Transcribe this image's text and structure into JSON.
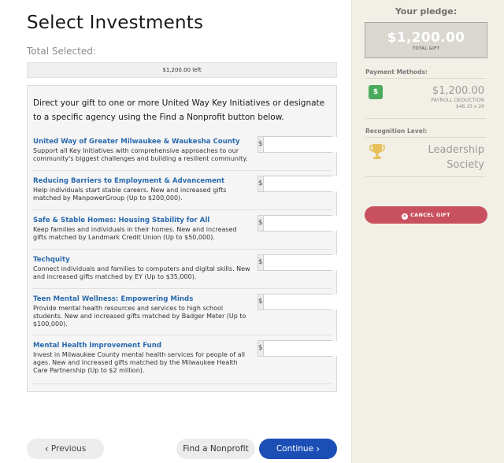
{
  "page": {
    "title": "Select Investments",
    "total_selected_label": "Total Selected:",
    "remaining_text": "$1,200.00 left",
    "allocated_fraction": 0,
    "intro": "Direct your gift to one or more United Way Key Initiatives or designate to a specific agency using the Find a Nonprofit button below."
  },
  "initiatives": [
    {
      "name": "United Way of Greater Milwaukee & Waukesha County",
      "description": "Support all Key Initiatives with comprehensive approaches to our community's biggest challenges and building a resilient community.",
      "currency": "$",
      "amount": "0"
    },
    {
      "name": "Reducing Barriers to Employment & Advancement",
      "description": "Help individuals start stable careers. New and increased gifts matched by ManpowerGroup (Up to $200,000).",
      "currency": "$",
      "amount": "0"
    },
    {
      "name": "Safe & Stable Homes: Housing Stability for All",
      "description": "Keep families and individuals in their homes. New and increased gifts matched by Landmark Credit Union (Up to $50,000).",
      "currency": "$",
      "amount": "0"
    },
    {
      "name": "Techquity",
      "description": "Connect individuals and families to computers and digital skills. New and increased gifts matched by EY (Up to $35,000).",
      "currency": "$",
      "amount": "0"
    },
    {
      "name": "Teen Mental Wellness: Empowering Minds",
      "description": "Provide mental health resources and services to high school students. New and increased gifts matched by Badger Meter (Up to $100,000).",
      "currency": "$",
      "amount": "0"
    },
    {
      "name": "Mental Health Improvement Fund",
      "description": "Invest in Milwaukee County mental health services for people of all ages. New and increased gifts matched by the Milwaukee Health Care Partnership (Up to $2 million).",
      "currency": "$",
      "amount": "0"
    }
  ],
  "nav": {
    "previous_label": "Previous",
    "find_nonprofit_label": "Find a Nonprofit",
    "continue_label": "Continue"
  },
  "sidebar": {
    "pledge_title": "Your pledge:",
    "pledge_amount": "$1,200.00",
    "pledge_sub": "TOTAL GIFT",
    "payment_methods_label": "Payment Methods:",
    "payment_icon": "$",
    "payment_amount": "$1,200.00",
    "payment_type": "PAYROLL DEDUCTION",
    "payment_calc": "$46.15 x 26",
    "recognition_label": "Recognition Level:",
    "recognition_level": "Leadership Society",
    "cancel_label": "CANCEL GIFT",
    "cancel_icon": "×"
  },
  "colors": {
    "accent_blue": "#1b4fb6",
    "link_blue": "#2a6aad",
    "cancel_red": "#c9505e",
    "payment_green": "#4aab5c",
    "trophy_gold": "#e8c05a",
    "sidebar_bg": "#f2f0e6"
  }
}
